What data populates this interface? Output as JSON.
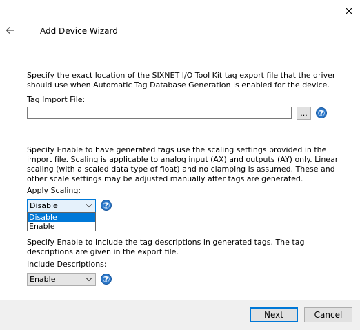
{
  "window": {
    "title": "Add Device Wizard",
    "close_icon": "close-icon",
    "back_icon": "back-arrow-icon"
  },
  "tag_import": {
    "description": "Specify the exact location of the SIXNET I/O Tool Kit tag export file that the driver should use when Automatic Tag Database Generation is enabled for the device.",
    "label": "Tag Import File:",
    "value": "",
    "browse_label": "...",
    "help_icon": "help-icon"
  },
  "scaling": {
    "description": "Specify Enable to have generated tags use the scaling settings provided in the import file. Scaling is applicable to analog input (AX) and outputs (AY) only. Linear scaling (with a scaled data type of float) and no clamping is assumed. These and other scale settings may be adjusted manually after tags are generated.",
    "label": "Apply Scaling:",
    "selected": "Disable",
    "options": [
      "Disable",
      "Enable"
    ],
    "help_icon": "help-icon"
  },
  "descriptions": {
    "description": "Specify Enable to include the tag descriptions in generated tags. The tag descriptions are given in the export file.",
    "label": "Include Descriptions:",
    "selected": "Enable",
    "help_icon": "help-icon"
  },
  "footer": {
    "next_label": "Next",
    "cancel_label": "Cancel"
  },
  "colors": {
    "accent": "#0078d7",
    "help_blue": "#2a76c8",
    "footer_bg": "#f0f0f0"
  }
}
